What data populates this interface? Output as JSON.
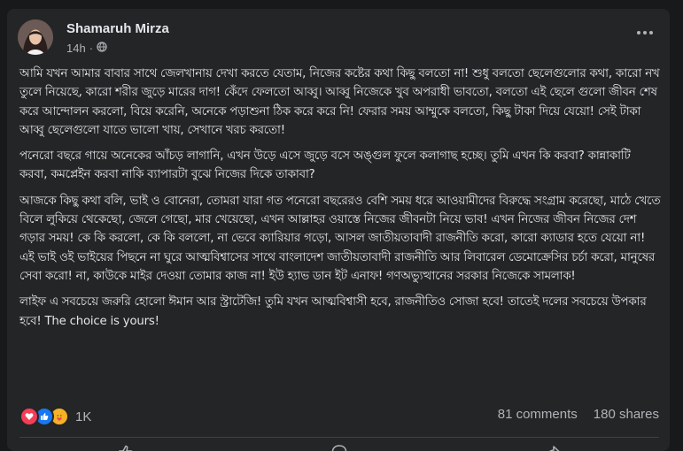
{
  "post": {
    "author": "Shamaruh Mirza",
    "time": "14h",
    "separator": "·",
    "privacy_icon": "globe-icon",
    "paragraphs": [
      "আমি যখন আমার বাবার সাথে জেলখানায় দেখা করতে যেতাম, নিজের কষ্টের কথা কিছু বলতো না! শুধু বলতো ছেলেগুলোর কথা, কারো নখ তুলে নিয়েছে, কারো শরীর জুড়ে মারের দাগ! কেঁদে ফেলতো আব্বু। আব্বু নিজেকে খুব অপরাধী ভাবতো, বলতো এই ছেলে গুলো জীবন শেষ করে আন্দোলন করলো, বিয়ে করেনি, অনেকে পড়াশুনা ঠিক করে করে নি! ফেরার সময় আম্মুকে বলতো, কিছু টাকা দিয়ে যেয়ো! সেই টাকা আব্বু ছেলেগুলো যাতে ভালো খায়, সেখানে খরচ করতো!",
      "পনেরো বছরে গায়ে অনেকের আঁচড় লাগানি, এখন উড়ে এসে জুড়ে বসে অঙ্গুল ফুলে কলাগাছ হচ্ছে। তুমি এখন কি করবা? কান্নাকাটি করবা, কমপ্লেইন করবা নাকি ব্যাপারটা বুঝে নিজের দিকে তাকাবা?",
      "আজকে কিছু কথা বলি, ভাই ও বোনেরা, তোমরা যারা গত পনেরো বছরেরও বেশি সময় ধরে আওয়ামীদের বিরুদ্ধে সংগ্রাম করেছো, মাঠে খেতে বিলে লুকিয়ে থেকেছো, জেলে গেছো, মার খেয়েছো, এখন আল্লাহর ওয়াস্তে নিজের জীবনটা নিয়ে ভাব! এখন নিজের জীবন নিজের দেশ গড়ার সময়! কে কি করলো, কে কি বললো, না ভেবে ক্যারিয়ার গড়ো, আসল জাতীয়তাবাদী রাজনীতি করো, কারো ক্যাডার হতে যেয়ো না! এই ভাই ওই ভাইয়ের পিছনে না ঘুরে আত্মবিশ্বাসের সাথে বাংলাদেশ জাতীয়তাবাদী রাজনীতি আর লিবারেল ডেমোক্রেসির চর্চা করো, মানুষের সেবা করো! না, কাউকে মাইর দেওয়া তোমার কাজ না! ইউ হ্যাভ ডান ইট এনাফ! গণঅভ্যুত্থানের সরকার নিজেকে সামলাক!",
      "লাইফ এ সবচেয়ে জরুরি হোলো ঈমান আর স্ট্রাটেজি! তুমি যখন আত্মবিশ্বাসী হবে, রাজনীতিও সোজা হবে! তাতেই দলের সবচেয়ে উপকার হবে! The choice is yours!"
    ]
  },
  "stats": {
    "reaction_icons": [
      "love-icon",
      "like-icon",
      "care-icon"
    ],
    "reaction_count": "1K",
    "comments": "81 comments",
    "shares": "180 shares"
  },
  "colors": {
    "background": "#18191a",
    "card": "#242526",
    "text_primary": "#e4e6eb",
    "text_secondary": "#b0b3b8",
    "like_blue": "#1877f2",
    "love_red": "#f33e58",
    "care_yellow": "#f7b125"
  }
}
